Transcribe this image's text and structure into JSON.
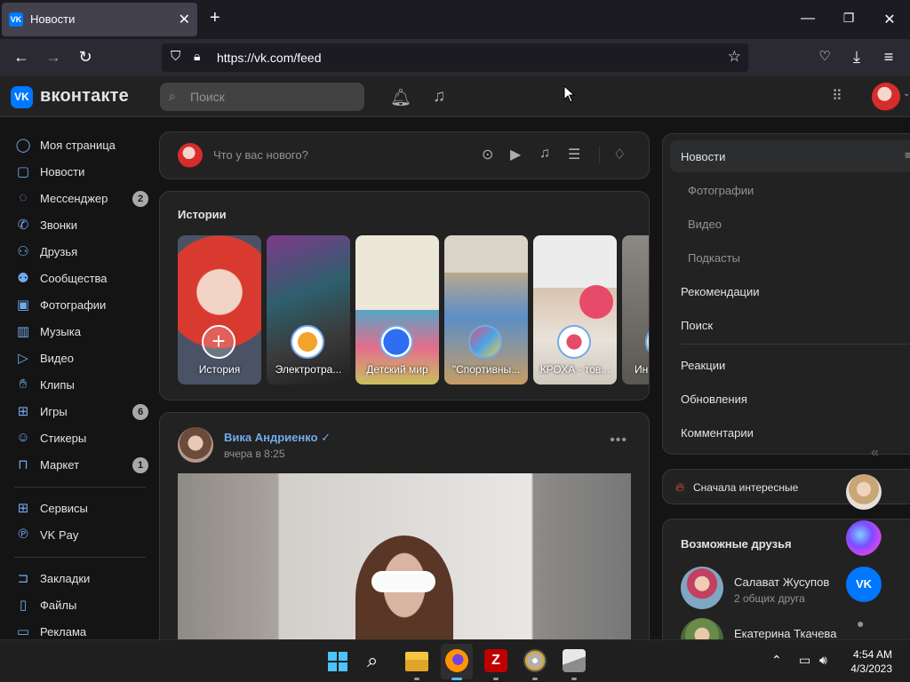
{
  "browser": {
    "tab_title": "Новости",
    "tab_favicon": "VK",
    "url": "https://vk.com/feed"
  },
  "header": {
    "brand": "вконтакте",
    "logo": "VK",
    "search_placeholder": "Поиск"
  },
  "sidebar": {
    "items": [
      {
        "label": "Моя страница",
        "icon": "user-circle-icon"
      },
      {
        "label": "Новости",
        "icon": "news-icon"
      },
      {
        "label": "Мессенджер",
        "icon": "chat-icon",
        "badge": "2"
      },
      {
        "label": "Звонки",
        "icon": "phone-icon"
      },
      {
        "label": "Друзья",
        "icon": "friends-icon"
      },
      {
        "label": "Сообщества",
        "icon": "communities-icon"
      },
      {
        "label": "Фотографии",
        "icon": "photo-icon"
      },
      {
        "label": "Музыка",
        "icon": "music-icon"
      },
      {
        "label": "Видео",
        "icon": "video-icon"
      },
      {
        "label": "Клипы",
        "icon": "clips-icon"
      },
      {
        "label": "Игры",
        "icon": "gamepad-icon",
        "badge": "6"
      },
      {
        "label": "Стикеры",
        "icon": "sticker-icon"
      },
      {
        "label": "Маркет",
        "icon": "market-icon",
        "badge": "1"
      }
    ],
    "services": [
      {
        "label": "Сервисы",
        "icon": "services-icon"
      },
      {
        "label": "VK Pay",
        "icon": "vkpay-icon"
      }
    ],
    "extra": [
      {
        "label": "Закладки",
        "icon": "bookmark-icon"
      },
      {
        "label": "Файлы",
        "icon": "file-icon"
      },
      {
        "label": "Реклама",
        "icon": "ads-icon"
      }
    ]
  },
  "composer": {
    "placeholder": "Что у вас нового?"
  },
  "stories": {
    "title": "Истории",
    "items": [
      {
        "label": "История",
        "bg": "#c8372d"
      },
      {
        "label": "Электротра...",
        "bg": "#3c3f52"
      },
      {
        "label": "Детский мир",
        "bg": "#e7e2d3"
      },
      {
        "label": "\"Спортивны...",
        "bg": "#c9b9a5"
      },
      {
        "label": "КРОХА - тов...",
        "bg": "#e6e2dd"
      },
      {
        "label": "Ин",
        "bg": "#6d6a66"
      }
    ]
  },
  "post": {
    "author": "Вика Андриенко",
    "verified": "✓",
    "time": "вчера в 8:25"
  },
  "right_menu": {
    "items": [
      {
        "label": "Новости",
        "sub": false
      },
      {
        "label": "Фотографии",
        "sub": true
      },
      {
        "label": "Видео",
        "sub": true
      },
      {
        "label": "Подкасты",
        "sub": true
      },
      {
        "label": "Рекомендации",
        "sub": false
      },
      {
        "label": "Поиск",
        "sub": false
      },
      {
        "label": "Реакции",
        "sub": false
      },
      {
        "label": "Обновления",
        "sub": false
      },
      {
        "label": "Комментарии",
        "sub": false
      }
    ],
    "sort_label": "Сначала интересные"
  },
  "friends": {
    "title": "Возможные друзья",
    "items": [
      {
        "name": "Салават Жусупов",
        "mutual": "2 общих друга"
      },
      {
        "name": "Екатерина Ткачева",
        "mutual": ""
      }
    ]
  },
  "taskbar": {
    "time": "4:54 AM",
    "date": "4/3/2023"
  }
}
